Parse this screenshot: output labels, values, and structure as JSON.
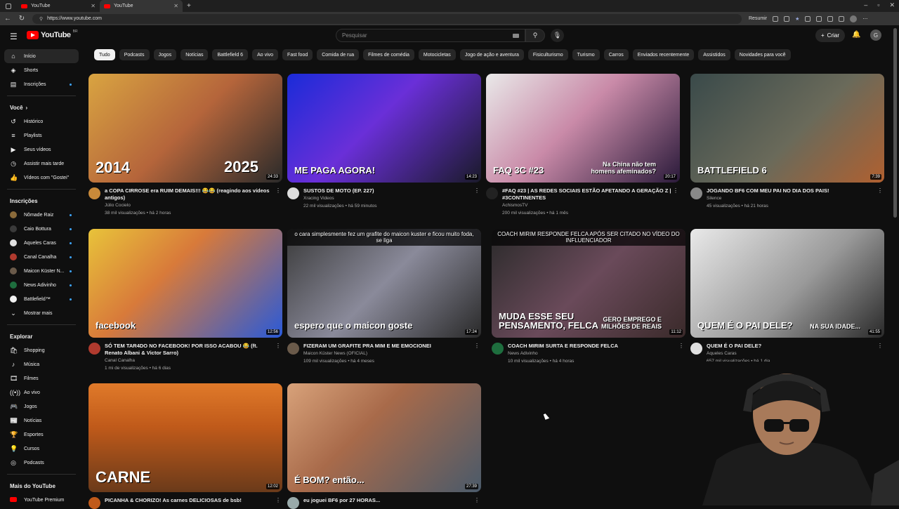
{
  "browser": {
    "tabs": [
      {
        "label": "YouTube",
        "active": false
      },
      {
        "label": "YouTube",
        "active": true
      }
    ],
    "url": "https://www.youtube.com",
    "resume_label": "Resumir"
  },
  "header": {
    "logo_text": "YouTube",
    "logo_badge": "BR",
    "search_placeholder": "Pesquisar",
    "create_label": "Criar",
    "avatar_letter": "G"
  },
  "sidebar": {
    "main": [
      {
        "icon": "home-icon",
        "glyph": "⌂",
        "label": "Início",
        "active": true
      },
      {
        "icon": "shorts-icon",
        "glyph": "◈",
        "label": "Shorts"
      },
      {
        "icon": "subscriptions-icon",
        "glyph": "▤",
        "label": "Inscrições",
        "dot": true
      }
    ],
    "you_heading": "Você",
    "you": [
      {
        "icon": "history-icon",
        "glyph": "↺",
        "label": "Histórico"
      },
      {
        "icon": "playlists-icon",
        "glyph": "≡",
        "label": "Playlists"
      },
      {
        "icon": "your-videos-icon",
        "glyph": "▶",
        "label": "Seus vídeos"
      },
      {
        "icon": "watch-later-icon",
        "glyph": "◷",
        "label": "Assistir mais tarde"
      },
      {
        "icon": "liked-icon",
        "glyph": "👍",
        "label": "Vídeos com \"Gostei\""
      }
    ],
    "subs_heading": "Inscrições",
    "subs": [
      {
        "label": "Nômade Raiz",
        "color": "#8a6a3a"
      },
      {
        "label": "Caio Bottura",
        "color": "#3a3a3a"
      },
      {
        "label": "Aqueles Caras",
        "color": "#e0e0e0"
      },
      {
        "label": "Canal Canalha",
        "color": "#b03a2e"
      },
      {
        "label": "Maicon Küster N...",
        "color": "#6a5a4a"
      },
      {
        "label": "News Adivinho",
        "color": "#1e6e3e"
      },
      {
        "label": "Battlefield™",
        "color": "#f1f1f1"
      }
    ],
    "show_more": "Mostrar mais",
    "explore_heading": "Explorar",
    "explore": [
      {
        "icon": "shopping-icon",
        "glyph": "🛍",
        "label": "Shopping"
      },
      {
        "icon": "music-icon",
        "glyph": "♪",
        "label": "Música"
      },
      {
        "icon": "movies-icon",
        "glyph": "🎞",
        "label": "Filmes"
      },
      {
        "icon": "live-icon",
        "glyph": "((•))",
        "label": "Ao vivo"
      },
      {
        "icon": "gaming-icon",
        "glyph": "🎮",
        "label": "Jogos"
      },
      {
        "icon": "news-icon",
        "glyph": "📰",
        "label": "Notícias"
      },
      {
        "icon": "sports-icon",
        "glyph": "🏆",
        "label": "Esportes"
      },
      {
        "icon": "courses-icon",
        "glyph": "💡",
        "label": "Cursos"
      },
      {
        "icon": "podcasts-icon",
        "glyph": "◎",
        "label": "Podcasts"
      }
    ],
    "more_heading": "Mais do YouTube",
    "more": [
      {
        "icon": "premium-icon",
        "label": "YouTube Premium"
      }
    ]
  },
  "chips": [
    "Tudo",
    "Podcasts",
    "Jogos",
    "Notícias",
    "Battlefield 6",
    "Ao vivo",
    "Fast food",
    "Comida de rua",
    "Filmes de comédia",
    "Motocicletas",
    "Jogo de ação e aventura",
    "Fisiculturismo",
    "Turismo",
    "Carros",
    "Enviados recentemente",
    "Assistidos",
    "Novidades para você"
  ],
  "videos": [
    {
      "title": "a COPA CIRROSE era RUIM DEMAIS!!! 😂😂 (reagindo aos vídeos antigos)",
      "channel": "Júlio Cocielo",
      "stats": "38 mil visualizações • há 2 horas",
      "duration": "24:33",
      "bg": "linear-gradient(135deg,#d9a441,#b5653b 50%,#2a2a2a)",
      "avatar": "#c98a3a",
      "overlay_left": "2014",
      "overlay_right": "2025"
    },
    {
      "title": "SUSTOS DE MOTO (EP. 227)",
      "channel": "Xracing Videos",
      "stats": "22 mil visualizações • há 59 minutos",
      "duration": "14:23",
      "bg": "linear-gradient(135deg,#1a2bd8,#6a2fd8 45%,#1a1a2a)",
      "avatar": "#dddddd",
      "overlay_left": "ME PAGA AGORA!"
    },
    {
      "title": "#FAQ #23 | AS REDES SOCIAIS ESTÃO AFETANDO A GERAÇÃO Z | #3CONTINENTES",
      "channel": "AchismosTV",
      "stats": "200 mil visualizações • há 1 mês",
      "duration": "20:17",
      "bg": "linear-gradient(135deg,#e9e9e9,#c98aa8 45%,#2a1a3a)",
      "avatar": "#222222",
      "overlay_left": "FAQ 3C #23",
      "overlay_right": "Na China não tem homens afeminados?"
    },
    {
      "title": "JOGANDO BF6 COM MEU PAI NO DIA DOS PAIS!",
      "channel": "Silence",
      "stats": "45 visualizações • há 21 horas",
      "duration": "7:39",
      "bg": "linear-gradient(135deg,#3a4a4a,#6a6a5a 55%,#b06030)",
      "avatar": "#888888",
      "overlay_left": "BATTLEFIELD 6"
    },
    {
      "title": "SÓ TEM TAR4DO NO FACEBOOK! POR ISSO ACABOU 😂 (ft. Renato Albani & Victor Sarro)",
      "channel": "Canal Canalha",
      "stats": "1 mi de visualizações • há 6 dias",
      "duration": "12:56",
      "bg": "linear-gradient(135deg,#e8c33a,#d87a3a 40%,#2a5ad8)",
      "avatar": "#b03a2e",
      "overlay_left": "facebook"
    },
    {
      "title": "FIZERAM UM GRAFITE PRA MIM E ME EMOCIONEI",
      "channel": "Maicon Küster News (OFICIAL)",
      "stats": "109 mil visualizações • há 4 meses",
      "duration": "17:24",
      "bg": "linear-gradient(135deg,#3a3a3a,#8a8a9a 50%,#2a2a2a)",
      "avatar": "#6a5a4a",
      "overlay_top": "o cara simplesmente fez um grafite do maicon kuster e ficou muito foda, se liga",
      "overlay_left": "espero que o maicon goste"
    },
    {
      "title": "COACH MIRIM SURTA E RESPONDE FELCA",
      "channel": "News Adivinho",
      "stats": "10 mil visualizações • há 4 horas",
      "duration": "11:12",
      "bg": "linear-gradient(135deg,#2a2a2a,#6a4a5a 50%,#3a2a2a)",
      "avatar": "#1e6e3e",
      "overlay_top": "COACH MIRIM RESPONDE FELCA APÓS SER CITADO NO VÍDEO DO INFLUENCIADOR",
      "overlay_left": "MUDA ESSE SEU PENSAMENTO, FELCA",
      "overlay_right": "GERO EMPREGO E MILHÕES DE REAIS"
    },
    {
      "title": "QUEM É O PAI DELE?",
      "channel": "Aqueles Caras",
      "stats": "657 mil visualizações • há 1 dia",
      "duration": "41:55",
      "bg": "linear-gradient(135deg,#e9e9e9,#9a9a9a 55%,#2a2a2a)",
      "avatar": "#e0e0e0",
      "overlay_left": "QUEM É O PAI DELE?",
      "overlay_right": "NA SUA IDADE..."
    },
    {
      "title": "PICANHA & CHORIZO! As carnes DELICIOSAS de bsb!",
      "channel": "",
      "stats": "",
      "duration": "12:02",
      "bg": "linear-gradient(180deg,#e07a2a,#c05a1a 40%,#6a3a1a)",
      "avatar": "#c05a1a",
      "overlay_left": "CARNE"
    },
    {
      "title": "eu joguei BF6 por 27 HORAS...",
      "channel": "",
      "stats": "",
      "duration": "27:39",
      "bg": "linear-gradient(135deg,#d8a27a,#a86a4a 40%,#4a5a6a)",
      "avatar": "#9aa",
      "overlay_left": "É BOM? então..."
    }
  ]
}
